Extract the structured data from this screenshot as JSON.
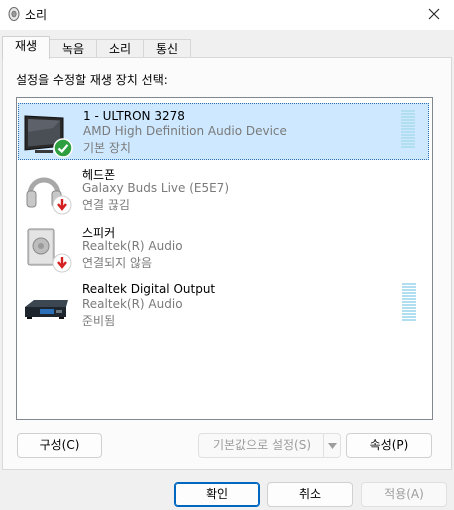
{
  "window": {
    "title": "소리",
    "close_icon": "close-icon",
    "app_icon": "speaker-icon"
  },
  "tabs": [
    {
      "label": "재생",
      "active": true
    },
    {
      "label": "녹음",
      "active": false
    },
    {
      "label": "소리",
      "active": false
    },
    {
      "label": "통신",
      "active": false
    }
  ],
  "instruction": "설정을 수정할 재생 장치 선택:",
  "devices": [
    {
      "name": "1 - ULTRON 3278",
      "driver": "AMD High Definition Audio Device",
      "status": "기본 장치",
      "icon": "monitor-icon",
      "badge": "check-badge-icon",
      "selected": true,
      "level_meter": true
    },
    {
      "name": "헤드폰",
      "driver": "Galaxy Buds Live (E5E7)",
      "status": "연결 끊김",
      "icon": "headphones-icon",
      "badge": "down-arrow-badge-icon",
      "selected": false,
      "level_meter": false
    },
    {
      "name": "스피커",
      "driver": "Realtek(R) Audio",
      "status": "연결되지 않음",
      "icon": "speaker-box-icon",
      "badge": "down-arrow-badge-icon",
      "selected": false,
      "level_meter": false
    },
    {
      "name": "Realtek Digital Output",
      "driver": "Realtek(R) Audio",
      "status": "준비됨",
      "icon": "digital-output-icon",
      "badge": "",
      "selected": false,
      "level_meter": true
    }
  ],
  "buttons": {
    "configure": "구성(C)",
    "set_default": "기본값으로 설정(S)",
    "properties": "속성(P)",
    "ok": "확인",
    "cancel": "취소",
    "apply": "적용(A)"
  },
  "colors": {
    "selection_bg": "#cde8ff",
    "accent": "#0067c0",
    "meter": "#b2def2"
  }
}
